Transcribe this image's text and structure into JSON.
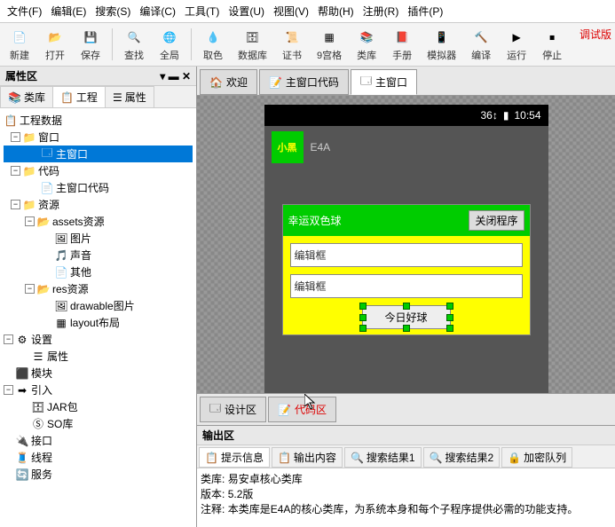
{
  "menu": [
    "文件(F)",
    "编辑(E)",
    "搜索(S)",
    "编译(C)",
    "工具(T)",
    "设置(U)",
    "视图(V)",
    "帮助(H)",
    "注册(R)",
    "插件(P)"
  ],
  "toolbar": [
    {
      "label": "新建",
      "icon": "file-new"
    },
    {
      "label": "打开",
      "icon": "folder-open"
    },
    {
      "label": "保存",
      "icon": "disk"
    },
    {
      "sep": true
    },
    {
      "label": "查找",
      "icon": "search"
    },
    {
      "label": "全局",
      "icon": "globe"
    },
    {
      "sep": true
    },
    {
      "label": "取色",
      "icon": "dropper"
    },
    {
      "label": "数据库",
      "icon": "db"
    },
    {
      "label": "证书",
      "icon": "cert"
    },
    {
      "label": "9宫格",
      "icon": "grid9"
    },
    {
      "label": "类库",
      "icon": "lib"
    },
    {
      "label": "手册",
      "icon": "book"
    },
    {
      "label": "模拟器",
      "icon": "phone"
    },
    {
      "label": "编译",
      "icon": "compile"
    },
    {
      "label": "运行",
      "icon": "play"
    },
    {
      "label": "停止",
      "icon": "stop"
    }
  ],
  "debug_label": "调试版",
  "left_panel": {
    "title": "属性区",
    "close": "×"
  },
  "left_tabs": [
    {
      "label": "类库",
      "icon": "lib"
    },
    {
      "label": "工程",
      "icon": "proj",
      "active": true
    },
    {
      "label": "属性",
      "icon": "prop"
    }
  ],
  "tree": {
    "root": "工程数据",
    "window": "窗口",
    "main_window": "主窗口",
    "code": "代码",
    "main_window_code": "主窗口代码",
    "resources": "资源",
    "assets": "assets资源",
    "image": "图片",
    "sound": "声音",
    "other": "其他",
    "res": "res资源",
    "drawable": "drawable图片",
    "layout": "layout布局",
    "settings": "设置",
    "property": "属性",
    "module": "模块",
    "import": "引入",
    "jar": "JAR包",
    "so": "SO库",
    "interface": "接口",
    "thread": "线程",
    "service": "服务"
  },
  "doc_tabs": [
    {
      "label": "欢迎",
      "icon": "home"
    },
    {
      "label": "主窗口代码",
      "icon": "code"
    },
    {
      "label": "主窗口",
      "icon": "window",
      "active": true
    }
  ],
  "phone": {
    "time": "10:54",
    "signal": "36↕",
    "app_icon_text": "小黑",
    "app_title": "E4A",
    "panel_title": "幸运双色球",
    "close_prog": "关闭程序",
    "edit1": "编辑框",
    "edit2": "编辑框",
    "today_ball": "今日好球"
  },
  "bottom_tabs": [
    {
      "label": "设计区",
      "icon": "design"
    },
    {
      "label": "代码区",
      "icon": "code",
      "active": true
    }
  ],
  "output": {
    "title": "输出区",
    "tabs": [
      {
        "label": "提示信息",
        "active": true
      },
      {
        "label": "输出内容"
      },
      {
        "label": "搜索结果1"
      },
      {
        "label": "搜索结果2"
      },
      {
        "label": "加密队列"
      }
    ],
    "lines": {
      "l1_k": "类库:",
      "l1_v": "易安卓核心类库",
      "l2_k": "版本:",
      "l2_v": "5.2版",
      "l3_k": "注释:",
      "l3_v": "本类库是E4A的核心类库，为系统本身和每个子程序提供必需的功能支持。"
    }
  }
}
